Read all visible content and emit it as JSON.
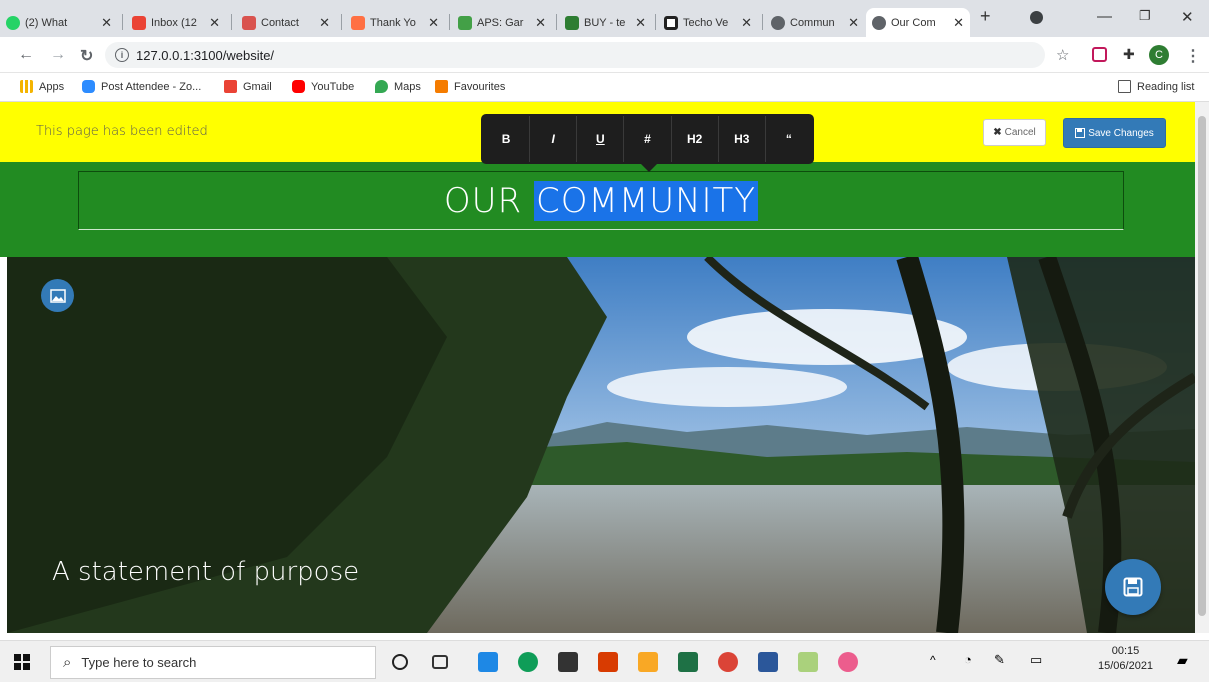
{
  "browser": {
    "tabs": [
      {
        "label": "(2) What",
        "color": "#25d366"
      },
      {
        "label": "Inbox (12",
        "color": "#ea4335"
      },
      {
        "label": "Contact",
        "color": "#d9534f"
      },
      {
        "label": "Thank Yo",
        "color": "#ff7043"
      },
      {
        "label": "APS: Gar",
        "color": "#43a047"
      },
      {
        "label": "BUY - te",
        "color": "#2e7d32"
      },
      {
        "label": "Techo Ve",
        "color": "#222222"
      },
      {
        "label": "Commun",
        "color": "#5f6368"
      },
      {
        "label": "Our Com",
        "color": "#5f6368"
      }
    ],
    "url": "127.0.0.1:3100/website/",
    "bookmarks": [
      {
        "label": "Apps",
        "color": "#f4b400"
      },
      {
        "label": "Post Attendee - Zo...",
        "color": "#2d8cff"
      },
      {
        "label": "Gmail",
        "color": "#ea4335"
      },
      {
        "label": "YouTube",
        "color": "#ff0000"
      },
      {
        "label": "Maps",
        "color": "#34a853"
      },
      {
        "label": "Favourites",
        "color": "#f57c00"
      }
    ],
    "reading_list": "Reading list",
    "profile_initial": "C"
  },
  "editor": {
    "banner_message": "This page has been edited",
    "toolbar": [
      "B",
      "I",
      "U",
      "#",
      "H2",
      "H3",
      "“"
    ],
    "cancel_label": "Cancel",
    "save_label": "Save Changes"
  },
  "page": {
    "title_before": "OUR",
    "title_selected": "COMMUNITY",
    "hero_caption": "A statement of purpose"
  },
  "taskbar": {
    "search_placeholder": "Type here to search",
    "time": "00:15",
    "date": "15/06/2021"
  },
  "colors": {
    "banner": "#ffff00",
    "header_green": "#228b22",
    "primary_blue": "#337ab7",
    "selection": "#1a73e8"
  }
}
